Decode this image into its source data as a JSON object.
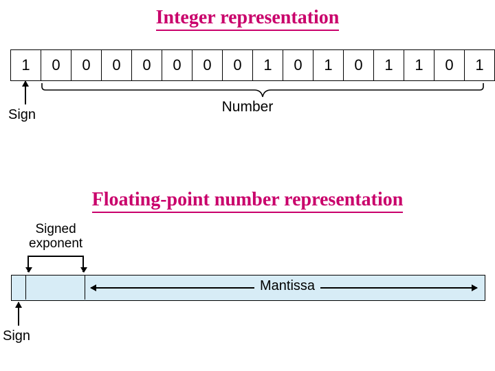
{
  "titles": {
    "integer": "Integer representation",
    "float": "Floating-point number representation"
  },
  "integer": {
    "bits": [
      "1",
      "0",
      "0",
      "0",
      "0",
      "0",
      "0",
      "0",
      "1",
      "0",
      "1",
      "0",
      "1",
      "1",
      "0",
      "1"
    ],
    "sign_label": "Sign",
    "number_label": "Number"
  },
  "float": {
    "exponent_label_line1": "Signed",
    "exponent_label_line2": "exponent",
    "mantissa_label": "Mantissa",
    "sign_label": "Sign"
  }
}
